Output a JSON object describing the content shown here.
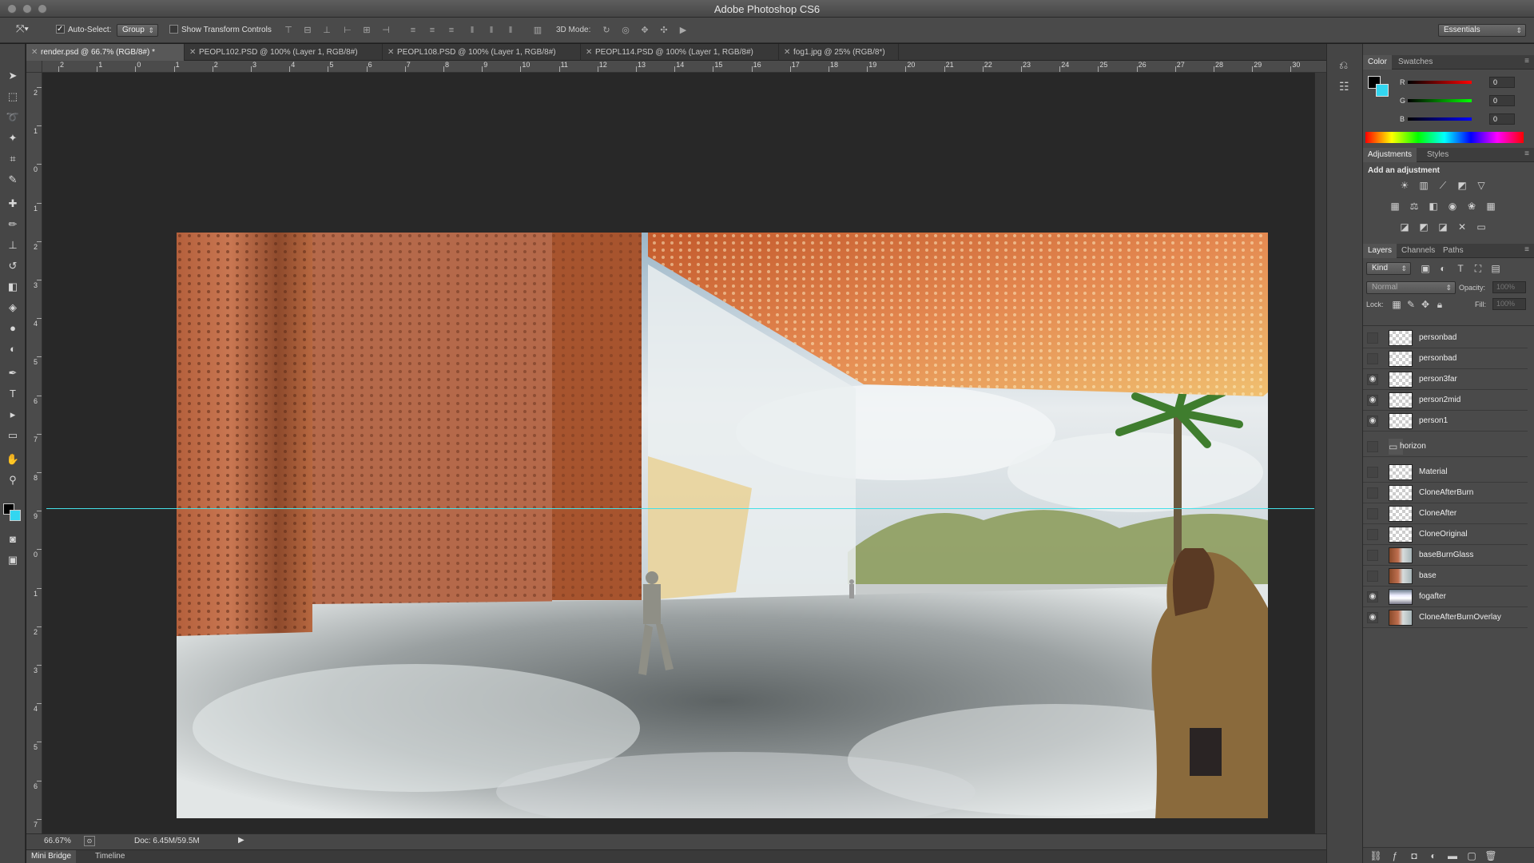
{
  "window": {
    "title": "Adobe Photoshop CS6"
  },
  "options_bar": {
    "auto_select_label": "Auto-Select:",
    "auto_select_checked": true,
    "auto_select_mode": "Group",
    "show_transform_label": "Show Transform Controls",
    "show_transform_checked": false,
    "mode_3d_label": "3D Mode:",
    "workspace": "Essentials"
  },
  "document_tabs": [
    {
      "label": "render.psd @ 66.7% (RGB/8#) *",
      "active": true
    },
    {
      "label": "PEOPL102.PSD @ 100% (Layer 1, RGB/8#)",
      "active": false
    },
    {
      "label": "PEOPL108.PSD @ 100% (Layer 1, RGB/8#)",
      "active": false
    },
    {
      "label": "PEOPL114.PSD @ 100% (Layer 1, RGB/8#)",
      "active": false
    },
    {
      "label": "fog1.jpg @ 25% (RGB/8*)",
      "active": false
    }
  ],
  "ruler": {
    "horizontal": [
      "2",
      "1",
      "0",
      "1",
      "2",
      "3",
      "4",
      "5",
      "6",
      "7",
      "8",
      "9",
      "10",
      "11",
      "12",
      "13",
      "14",
      "15",
      "16",
      "17",
      "18",
      "19",
      "20",
      "21",
      "22",
      "23",
      "24",
      "25",
      "26",
      "27",
      "28",
      "29",
      "30"
    ],
    "vertical": [
      "2",
      "1",
      "0",
      "1",
      "2",
      "3",
      "4",
      "5",
      "6",
      "7",
      "8",
      "9",
      "0",
      "1",
      "2",
      "3",
      "4",
      "5",
      "6",
      "7"
    ]
  },
  "status": {
    "zoom": "66.67%",
    "doc": "Doc: 6.45M/59.5M"
  },
  "bottom_tabs": [
    "Mini Bridge",
    "Timeline"
  ],
  "color_panel": {
    "tabs": [
      "Color",
      "Swatches"
    ],
    "r_label": "R",
    "g_label": "G",
    "b_label": "B",
    "r": "0",
    "g": "0",
    "b": "0",
    "foreground": "#000000",
    "background": "#33d6f0"
  },
  "adjustments_panel": {
    "tabs": [
      "Adjustments",
      "Styles"
    ],
    "heading": "Add an adjustment"
  },
  "layers_panel": {
    "tabs": [
      "Layers",
      "Channels",
      "Paths"
    ],
    "filter": "Kind",
    "blend_mode": "Normal",
    "opacity_label": "Opacity:",
    "opacity": "100%",
    "lock_label": "Lock:",
    "fill_label": "Fill:",
    "fill": "100%",
    "layers": [
      {
        "name": "personbad",
        "visible": false,
        "thumb": "trans"
      },
      {
        "name": "personbad",
        "visible": false,
        "thumb": "trans"
      },
      {
        "name": "person3far",
        "visible": true,
        "thumb": "trans"
      },
      {
        "name": "person2mid",
        "visible": true,
        "thumb": "trans"
      },
      {
        "name": "person1",
        "visible": true,
        "thumb": "trans"
      },
      {
        "name": "horizon",
        "visible": false,
        "thumb": "folder"
      },
      {
        "name": "Material",
        "visible": false,
        "thumb": "trans"
      },
      {
        "name": "CloneAfterBurn",
        "visible": false,
        "thumb": "trans"
      },
      {
        "name": "CloneAfter",
        "visible": false,
        "thumb": "trans"
      },
      {
        "name": "CloneOriginal",
        "visible": false,
        "thumb": "trans"
      },
      {
        "name": "baseBurnGlass",
        "visible": false,
        "thumb": "img"
      },
      {
        "name": "base",
        "visible": false,
        "thumb": "img"
      },
      {
        "name": "fogafter",
        "visible": true,
        "thumb": "fog"
      },
      {
        "name": "CloneAfterBurnOverlay",
        "visible": true,
        "thumb": "img"
      }
    ]
  },
  "colors": {
    "guide": "#44e0e8"
  }
}
